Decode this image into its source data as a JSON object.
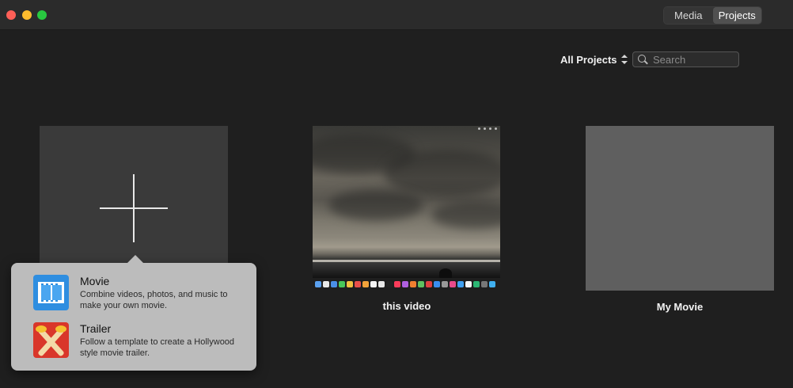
{
  "toolbar": {
    "tabs": [
      {
        "label": "Media",
        "selected": false
      },
      {
        "label": "Projects",
        "selected": true
      }
    ]
  },
  "filter": {
    "label": "All Projects"
  },
  "search": {
    "placeholder": "Search",
    "value": ""
  },
  "projects": [
    {
      "title": "this video"
    },
    {
      "title": "My Movie"
    }
  ],
  "new_project_menu": {
    "items": [
      {
        "title": "Movie",
        "desc_line1": "Combine videos, photos, and music to",
        "desc_line2": "make your own movie.",
        "icon": "film-icon"
      },
      {
        "title": "Trailer",
        "desc_line1": "Follow a template to create a Hollywood",
        "desc_line2": "style movie trailer.",
        "icon": "trailer-icon"
      }
    ]
  },
  "colors": {
    "background": "#1f1f1f",
    "close": "#fe5f57",
    "minimize": "#febc2e",
    "zoom": "#28c840",
    "popover": "#bcbcbc"
  }
}
